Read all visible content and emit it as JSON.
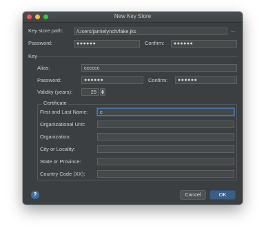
{
  "window": {
    "title": "New Key Store"
  },
  "keystore": {
    "path_label": "Key store path:",
    "path_value": "/Users/jamielynch/fake.jks",
    "browse_label": "...",
    "password_label": "Password:",
    "password_value": "●●●●●●",
    "confirm_label": "Confirm:",
    "confirm_value": "●●●●●●"
  },
  "key": {
    "section_label": "Key",
    "alias_label": "Alias:",
    "alias_value": "cccccc",
    "password_label": "Password:",
    "password_value": "●●●●●●",
    "confirm_label": "Confirm:",
    "confirm_value": "●●●●●●",
    "validity_label": "Validity (years):",
    "validity_value": "25"
  },
  "certificate": {
    "section_label": "Certificate",
    "fields": [
      {
        "label": "First and Last Name:",
        "value": "c"
      },
      {
        "label": "Organizational Unit:",
        "value": ""
      },
      {
        "label": "Organization:",
        "value": ""
      },
      {
        "label": "City or Locality:",
        "value": ""
      },
      {
        "label": "State or Province:",
        "value": ""
      },
      {
        "label": "Country Code (XX):",
        "value": ""
      }
    ]
  },
  "footer": {
    "help_label": "?",
    "cancel_label": "Cancel",
    "ok_label": "OK"
  }
}
